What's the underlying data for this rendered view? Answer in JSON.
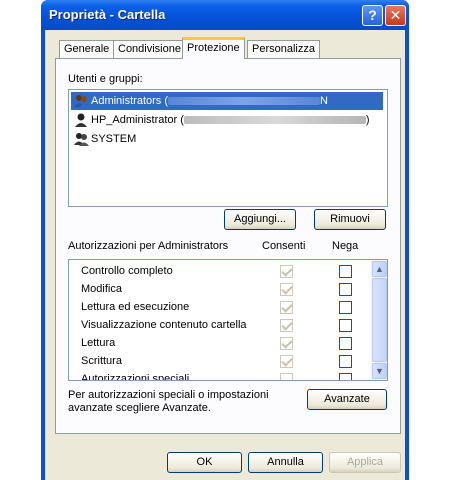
{
  "window": {
    "title": "Proprietà - Cartella",
    "help_glyph": "?",
    "close_glyph": "✕"
  },
  "tabs": [
    {
      "label": "Generale"
    },
    {
      "label": "Condivisione"
    },
    {
      "label": "Protezione",
      "active": true
    },
    {
      "label": "Personalizza"
    }
  ],
  "users": {
    "label": "Utenti e gruppi:",
    "items": [
      {
        "name": "Administrators (",
        "suffix": "N",
        "selected": true
      },
      {
        "name": "HP_Administrator (",
        "suffix": ")"
      },
      {
        "name": "SYSTEM",
        "suffix": ""
      }
    ],
    "add_label": "Aggiungi...",
    "remove_label": "Rimuovi"
  },
  "permissions": {
    "header": "Autorizzazioni per Administrators",
    "allow_header": "Consenti",
    "deny_header": "Nega",
    "rows": [
      {
        "name": "Controllo completo",
        "allow": true,
        "deny": false
      },
      {
        "name": "Modifica",
        "allow": true,
        "deny": false
      },
      {
        "name": "Lettura ed esecuzione",
        "allow": true,
        "deny": false
      },
      {
        "name": "Visualizzazione contenuto cartella",
        "allow": true,
        "deny": false
      },
      {
        "name": "Lettura",
        "allow": true,
        "deny": false
      },
      {
        "name": "Scrittura",
        "allow": true,
        "deny": false
      },
      {
        "name": "Autorizzazioni speciali",
        "allow": false,
        "deny": false
      }
    ]
  },
  "advanced": {
    "note": "Per autorizzazioni speciali o impostazioni avanzate scegliere Avanzate.",
    "button_label": "Avanzate"
  },
  "footer": {
    "ok_label": "OK",
    "cancel_label": "Annulla",
    "apply_label": "Applica"
  },
  "colors": {
    "title_bar": "#0a5fe8",
    "selection": "#316ac5",
    "dialog_bg": "#ece9d8"
  }
}
